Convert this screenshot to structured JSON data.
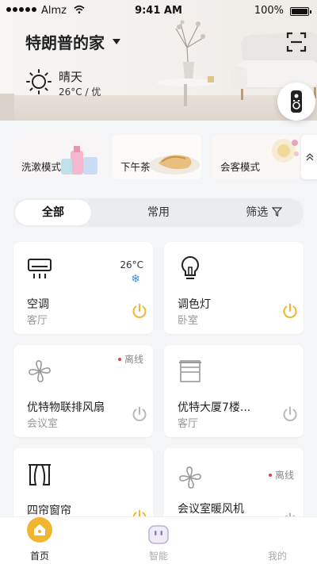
{
  "status_bar": {
    "carrier": "Almz",
    "time": "9:41 AM",
    "battery": "100%"
  },
  "header": {
    "home_name": "特朗普的家"
  },
  "weather": {
    "condition": "晴天",
    "detail": "26°C / 优"
  },
  "scenes": [
    {
      "label": "洗漱模式"
    },
    {
      "label": "下午茶"
    },
    {
      "label": "会客模式"
    }
  ],
  "tabs": [
    {
      "label": "全部"
    },
    {
      "label": "常用"
    },
    {
      "label": "筛选"
    }
  ],
  "devices": [
    {
      "name": "空调",
      "room": "客厅",
      "temp": "26°C",
      "mode_icon": "snowflake-icon",
      "on": true
    },
    {
      "name": "调色灯",
      "room": "卧室",
      "on": true
    },
    {
      "name": "优特物联排风扇",
      "room": "会议室",
      "status": "离线",
      "on": false
    },
    {
      "name": "优特大厦7楼...",
      "room": "客厅",
      "on": false
    },
    {
      "name": "四帘窗帘",
      "room": "",
      "on": true
    },
    {
      "name": "会议室暖风机",
      "room": "",
      "status": "离线",
      "on": false
    }
  ],
  "nav": [
    {
      "label": "首页"
    },
    {
      "label": "智能"
    },
    {
      "label": "我的"
    }
  ],
  "colors": {
    "accent": "#f1b52f",
    "power_on": "#f1b52f",
    "power_off": "#b8b8b8",
    "offline_dot": "#e24040",
    "snow": "#3a8ee6"
  }
}
